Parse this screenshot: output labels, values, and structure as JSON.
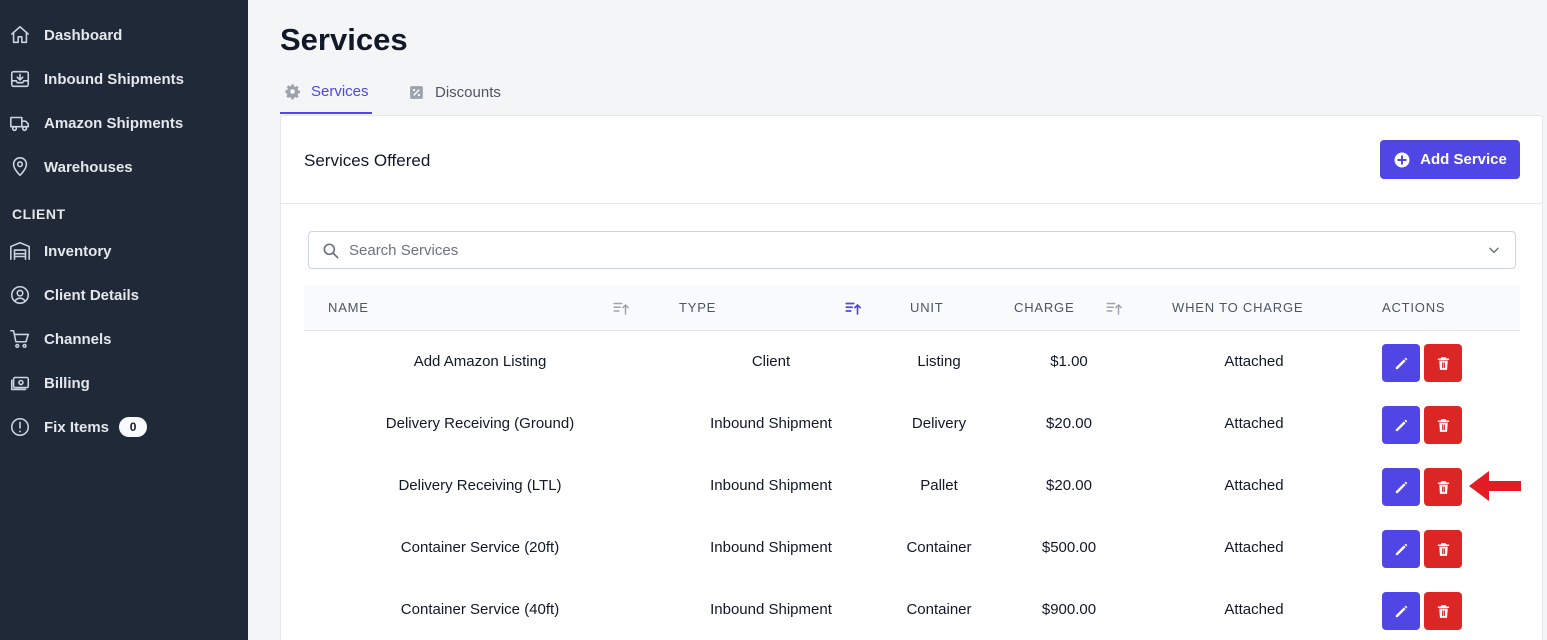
{
  "sidebar": {
    "items": [
      {
        "label": "Dashboard",
        "icon": "home-icon"
      },
      {
        "label": "Inbound Shipments",
        "icon": "inbox-in-icon"
      },
      {
        "label": "Amazon Shipments",
        "icon": "truck-icon"
      },
      {
        "label": "Warehouses",
        "icon": "map-pin-icon"
      }
    ],
    "section_label": "CLIENT",
    "client_items": [
      {
        "label": "Inventory",
        "icon": "warehouse-icon"
      },
      {
        "label": "Client Details",
        "icon": "user-circle-icon"
      },
      {
        "label": "Channels",
        "icon": "shopping-cart-icon"
      },
      {
        "label": "Billing",
        "icon": "cash-icon"
      },
      {
        "label": "Fix Items",
        "icon": "exclamation-circle-icon",
        "badge": "0"
      }
    ]
  },
  "page": {
    "title": "Services"
  },
  "tabs": [
    {
      "label": "Services",
      "icon": "gear-icon",
      "active": true
    },
    {
      "label": "Discounts",
      "icon": "receipt-percent-icon",
      "active": false
    }
  ],
  "card": {
    "title": "Services Offered",
    "add_button": "Add Service",
    "search_placeholder": "Search Services"
  },
  "table": {
    "headers": [
      "NAME",
      "TYPE",
      "UNIT",
      "CHARGE",
      "WHEN TO CHARGE",
      "ACTIONS"
    ],
    "rows": [
      {
        "name": "Add Amazon Listing",
        "type": "Client",
        "unit": "Listing",
        "charge": "$1.00",
        "when": "Attached"
      },
      {
        "name": "Delivery Receiving (Ground)",
        "type": "Inbound Shipment",
        "unit": "Delivery",
        "charge": "$20.00",
        "when": "Attached"
      },
      {
        "name": "Delivery Receiving (LTL)",
        "type": "Inbound Shipment",
        "unit": "Pallet",
        "charge": "$20.00",
        "when": "Attached"
      },
      {
        "name": "Container Service (20ft)",
        "type": "Inbound Shipment",
        "unit": "Container",
        "charge": "$500.00",
        "when": "Attached"
      },
      {
        "name": "Container Service (40ft)",
        "type": "Inbound Shipment",
        "unit": "Container",
        "charge": "$900.00",
        "when": "Attached"
      }
    ]
  },
  "colors": {
    "sidebar_bg": "#1f2937",
    "accent": "#4f46e5",
    "danger": "#dc2626",
    "annotation_arrow": "#e11d24"
  }
}
